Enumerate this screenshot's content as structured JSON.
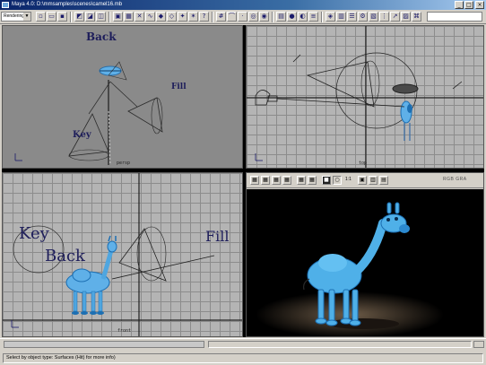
{
  "window": {
    "title": "Maya 4.0: D:\\mmsamples\\scenes\\camel16.mb",
    "minimize": "_",
    "maximize": "□",
    "close": "×"
  },
  "toolbar": {
    "mode": "Rendering",
    "icons": [
      "new-scene-icon",
      "open-scene-icon",
      "save-scene-icon",
      "select-hierarchy-icon",
      "select-object-icon",
      "select-component-icon",
      "lock-icon",
      "snap-grid-icon",
      "snap-curve-icon",
      "snap-point-icon",
      "snap-view-icon",
      "make-live-icon",
      "construction-history-icon",
      "render-icon",
      "ipr-render-icon",
      "render-globals-icon",
      "hypershade-icon",
      "render-view-icon",
      "attribute-editor-icon",
      "tool-settings-icon",
      "channel-box-icon",
      "outliner-icon",
      "graph-editor-icon",
      "layer-icon",
      "script-editor-icon"
    ]
  },
  "viewports": {
    "persp": {
      "name": "persp",
      "labels": {
        "back": "Back",
        "fill": "Fill",
        "key": "Key"
      }
    },
    "top": {
      "name": "top"
    },
    "front": {
      "name": "front",
      "labels": {
        "key": "Key",
        "back": "Back",
        "fill": "Fill"
      }
    },
    "render": {
      "ratio": "1:1",
      "channels": "RGB  GRA"
    }
  },
  "colors": {
    "camel": "#4fb0e8",
    "camel_shadow": "#1c6fb3",
    "ground": "#5a4a3a",
    "render_bg": "#000000",
    "title_bar": "#0a246a"
  },
  "helpline": {
    "text": "Select by object type: Surfaces (Hit) for more info)"
  }
}
